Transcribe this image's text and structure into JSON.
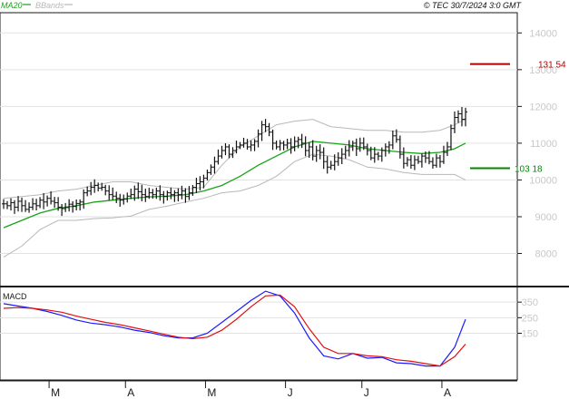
{
  "header": {
    "ma_label": "MA20",
    "ma_color": "#19a319",
    "bbands_label": "BBands",
    "bbands_color": "#b8b8b8",
    "copyright": "© TEC 30/7/2024 3:0 GMT"
  },
  "chart_data": [
    {
      "type": "ohlc",
      "panel": "price",
      "x_labels": [
        "M",
        "A",
        "M",
        "J",
        "J",
        "A"
      ],
      "yticks": [
        8000,
        9000,
        10000,
        11000,
        12000,
        13000,
        14000
      ],
      "yticks_display": [
        "8000",
        "9000",
        "10000",
        "11000",
        "12000",
        "13000",
        "14000"
      ],
      "ylim": [
        7100,
        14550
      ],
      "grid": true,
      "close": [
        9350,
        9300,
        9380,
        9260,
        9420,
        9300,
        9200,
        9260,
        9350,
        9300,
        9450,
        9400,
        9500,
        9420,
        9380,
        9260,
        9220,
        9250,
        9340,
        9280,
        9360,
        9400,
        9650,
        9700,
        9800,
        9850,
        9780,
        9800,
        9700,
        9600,
        9560,
        9500,
        9450,
        9480,
        9560,
        9600,
        9750,
        9680,
        9600,
        9550,
        9650,
        9600,
        9700,
        9600,
        9550,
        9650,
        9600,
        9650,
        9600,
        9700,
        9550,
        9650,
        9800,
        9900,
        9950,
        10050,
        10200,
        10350,
        10500,
        10650,
        10800,
        10900,
        10700,
        10800,
        10900,
        10950,
        11000,
        10900,
        10950,
        11050,
        11250,
        11500,
        11450,
        11300,
        11000,
        10900,
        11000,
        10950,
        11000,
        10900,
        11050,
        11100,
        11000,
        10800,
        10900,
        10650,
        10800,
        10750,
        10500,
        10350,
        10400,
        10500,
        10600,
        10700,
        10800,
        10900,
        11000,
        10850,
        11000,
        10900,
        10800,
        10600,
        10700,
        10650,
        10800,
        10900,
        10950,
        11200,
        11100,
        10700,
        10450,
        10550,
        10400,
        10550,
        10500,
        10650,
        10600,
        10500,
        10400,
        10600,
        10500,
        10750,
        10900,
        11400,
        11700,
        11800,
        11650,
        11850
      ],
      "series": [
        {
          "name": "MA20",
          "color": "#19a319",
          "x_index": [
            0,
            5,
            10,
            15,
            20,
            25,
            30,
            35,
            40,
            45,
            50,
            55,
            60,
            65,
            70,
            75,
            80,
            85,
            90,
            95,
            100,
            105,
            110,
            115,
            120,
            124,
            127
          ],
          "values": [
            8700,
            8900,
            9100,
            9230,
            9300,
            9400,
            9450,
            9500,
            9540,
            9560,
            9600,
            9700,
            9850,
            10100,
            10400,
            10650,
            10900,
            11050,
            11000,
            10950,
            10850,
            10800,
            10750,
            10720,
            10750,
            10850,
            11000
          ]
        },
        {
          "name": "BBands upper",
          "color": "#b8b8b8",
          "x_index": [
            0,
            5,
            10,
            15,
            20,
            25,
            30,
            35,
            40,
            45,
            50,
            55,
            60,
            65,
            70,
            75,
            80,
            85,
            90,
            95,
            100,
            105,
            110,
            115,
            120,
            124,
            127
          ],
          "values": [
            9500,
            9550,
            9600,
            9700,
            9750,
            9850,
            9950,
            9950,
            9850,
            9800,
            9750,
            9800,
            10400,
            10900,
            11200,
            11500,
            11600,
            11650,
            11450,
            11400,
            11350,
            11350,
            11300,
            11300,
            11350,
            11500,
            11650
          ]
        },
        {
          "name": "BBands lower",
          "color": "#b8b8b8",
          "x_index": [
            0,
            5,
            10,
            15,
            20,
            25,
            30,
            35,
            40,
            45,
            50,
            55,
            60,
            65,
            70,
            75,
            80,
            85,
            90,
            95,
            100,
            105,
            110,
            115,
            120,
            124,
            127
          ],
          "values": [
            7900,
            8200,
            8650,
            8900,
            8900,
            8950,
            8970,
            9020,
            9200,
            9290,
            9400,
            9500,
            9650,
            9700,
            9850,
            10100,
            10500,
            10700,
            10650,
            10550,
            10350,
            10300,
            10200,
            10150,
            10150,
            10150,
            10000
          ]
        }
      ],
      "levels": [
        {
          "value": 13154,
          "label": "131 54",
          "color": "#b30000"
        },
        {
          "value": 10318,
          "label": "103 18",
          "color": "#008a00"
        }
      ]
    },
    {
      "type": "line",
      "panel": "macd",
      "title": "MACD",
      "yticks": [
        150,
        250,
        350
      ],
      "ylim": [
        -150,
        450
      ],
      "grid": true,
      "series": [
        {
          "name": "MACD",
          "color": "#1c1cff",
          "x_index": [
            0,
            4,
            8,
            12,
            16,
            20,
            24,
            28,
            32,
            36,
            40,
            44,
            48,
            52,
            56,
            60,
            64,
            68,
            72,
            76,
            80,
            84,
            88,
            92,
            96,
            100,
            104,
            108,
            112,
            116,
            120,
            124,
            127
          ],
          "values": [
            340,
            325,
            310,
            290,
            265,
            235,
            215,
            205,
            190,
            170,
            155,
            135,
            120,
            120,
            150,
            220,
            290,
            360,
            420,
            390,
            280,
            120,
            5,
            -15,
            20,
            -10,
            -5,
            -40,
            -45,
            -60,
            -60,
            60,
            240
          ]
        },
        {
          "name": "Signal",
          "color": "#e01010",
          "x_index": [
            0,
            4,
            8,
            12,
            16,
            20,
            24,
            28,
            32,
            36,
            40,
            44,
            48,
            52,
            56,
            60,
            64,
            68,
            72,
            76,
            80,
            84,
            88,
            92,
            96,
            100,
            104,
            108,
            112,
            116,
            120,
            124,
            127
          ],
          "values": [
            310,
            315,
            310,
            300,
            285,
            260,
            240,
            220,
            205,
            185,
            165,
            145,
            125,
            115,
            125,
            170,
            240,
            320,
            390,
            395,
            320,
            180,
            60,
            20,
            20,
            5,
            0,
            -20,
            -30,
            -45,
            -60,
            0,
            80
          ]
        }
      ]
    }
  ]
}
